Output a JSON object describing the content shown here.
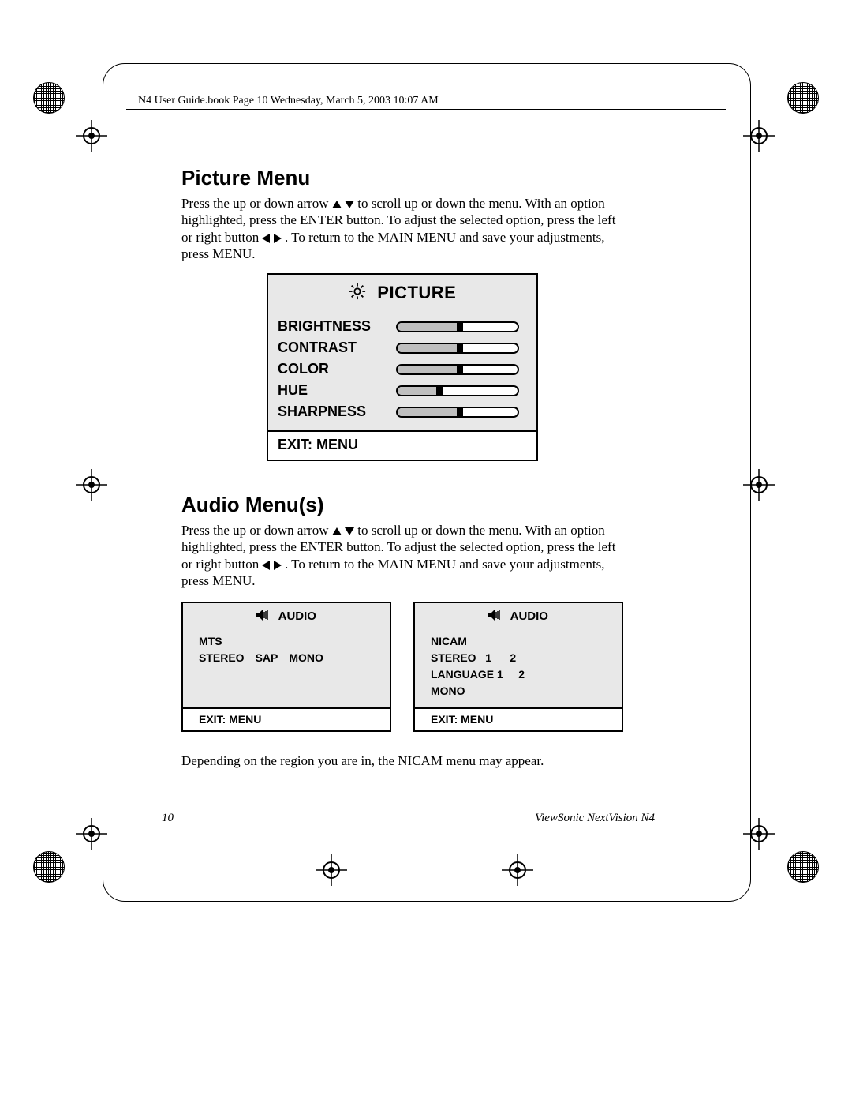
{
  "header": "N4 User Guide.book  Page 10  Wednesday, March 5, 2003  10:07 AM",
  "section1": {
    "title": "Picture Menu",
    "para_a": "Press the up or down arrow ",
    "para_b": " to scroll up or down the menu. With an option highlighted, press the ENTER button. To adjust the selected option, press the left or right button  ",
    "para_c": " . To return to the MAIN MENU and save your adjustments, press MENU."
  },
  "picture_osd": {
    "title": "PICTURE",
    "items": [
      {
        "label": "BRIGHTNESS",
        "value": 45
      },
      {
        "label": "CONTRAST",
        "value": 45
      },
      {
        "label": "COLOR",
        "value": 45
      },
      {
        "label": "HUE",
        "value": 30
      },
      {
        "label": "SHARPNESS",
        "value": 45
      }
    ],
    "footer": "EXIT:  MENU"
  },
  "section2": {
    "title": "Audio Menu(s)",
    "para_a": "Press the up or down arrow ",
    "para_b": " to scroll up or down the menu. With an option highlighted, press the ENTER button. To adjust the selected option, press the left or right button  ",
    "para_c": " . To return to the MAIN MENU and save your adjustments, press MENU."
  },
  "audio1": {
    "title": "AUDIO",
    "line1": "MTS",
    "opts": [
      "STEREO",
      "SAP",
      "MONO"
    ],
    "footer": "EXIT:  MENU"
  },
  "audio2": {
    "title": "AUDIO",
    "lines": [
      "NICAM",
      "STEREO   1      2",
      "LANGUAGE 1     2",
      "MONO"
    ],
    "footer": "EXIT:  MENU"
  },
  "note": "Depending on the region you are in, the NICAM menu may appear.",
  "footer": {
    "page": "10",
    "product": "ViewSonic   NextVision N4"
  }
}
